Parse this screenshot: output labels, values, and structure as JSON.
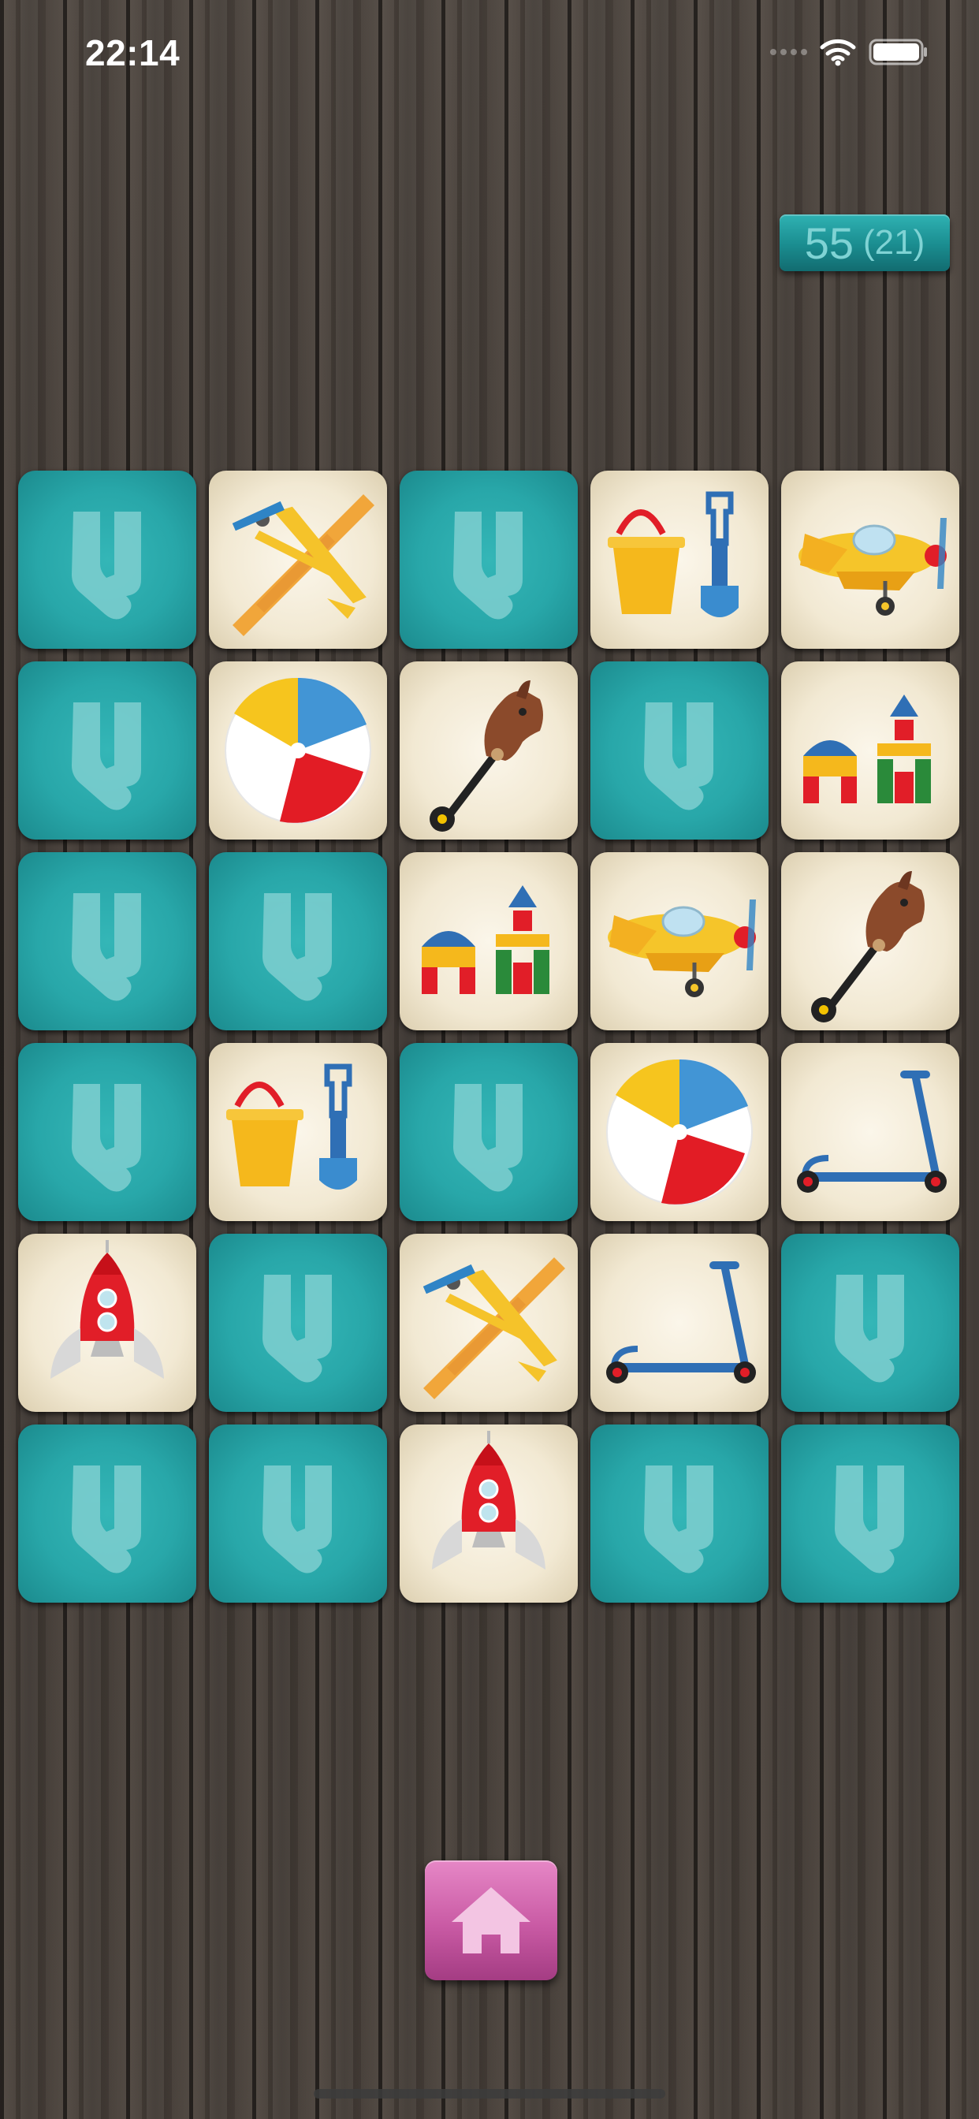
{
  "status_bar": {
    "time": "22:14"
  },
  "score": {
    "value": "55",
    "attempts": "(21)"
  },
  "board": {
    "columns": 5,
    "rows": 6,
    "cards": [
      [
        "socks",
        "airplane",
        "socks",
        "bucket-spade",
        "plane-yellow"
      ],
      [
        "socks",
        "beach-ball",
        "hobby-horse",
        "socks",
        "blocks"
      ],
      [
        "socks",
        "socks",
        "blocks",
        "plane-yellow",
        "hobby-horse"
      ],
      [
        "socks",
        "bucket-spade",
        "socks",
        "beach-ball",
        "scooter"
      ],
      [
        "rocket",
        "socks",
        "airplane",
        "scooter",
        "socks"
      ],
      [
        "socks",
        "socks",
        "rocket",
        "socks",
        "socks"
      ]
    ]
  },
  "colors": {
    "card_back": "#28a7a9",
    "card_face": "#f2e9d3",
    "home_button": "#c95aa4",
    "score_badge": "#1a8c8f"
  },
  "icons": {
    "home_button": "home-icon",
    "card_back": "socks-icon"
  }
}
